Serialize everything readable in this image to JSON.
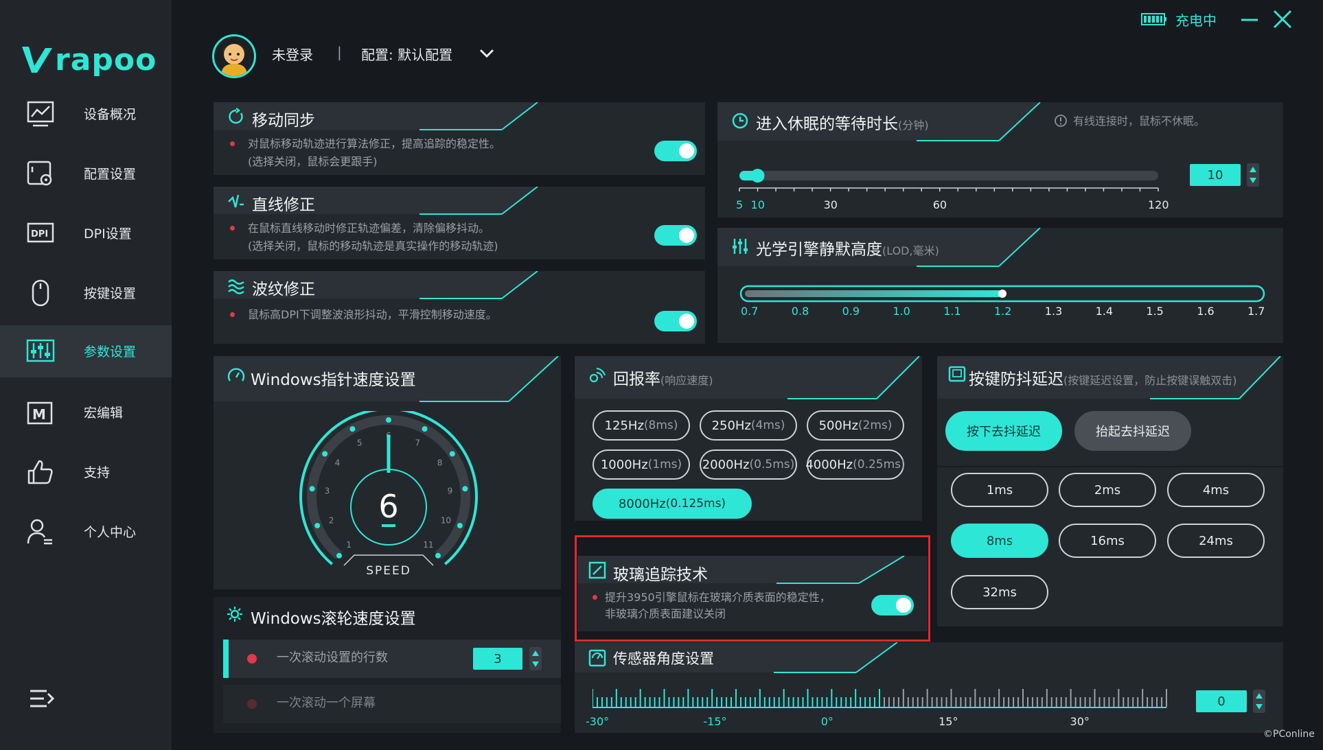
{
  "app": {
    "brand": "rapoo"
  },
  "window": {
    "charging_label": "充电中"
  },
  "user": {
    "status": "未登录",
    "separator": "|",
    "profile_label": "配置: 默认配置"
  },
  "sidebar": {
    "items": [
      {
        "label": "设备概况",
        "icon": "chart-monitor-icon"
      },
      {
        "label": "配置设置",
        "icon": "config-gear-icon"
      },
      {
        "label": "DPI设置",
        "icon": "dpi-icon"
      },
      {
        "label": "按键设置",
        "icon": "mouse-icon"
      },
      {
        "label": "参数设置",
        "icon": "sliders-icon",
        "active": true
      },
      {
        "label": "宏编辑",
        "icon": "macro-icon"
      },
      {
        "label": "支持",
        "icon": "thumbs-up-icon"
      },
      {
        "label": "个人中心",
        "icon": "user-icon"
      }
    ]
  },
  "motion_sync": {
    "title": "移动同步",
    "desc1": "对鼠标移动轨迹进行算法修正，提高追踪的稳定性。",
    "desc2": "(选择关闭，鼠标会更跟手)",
    "enabled": true
  },
  "angle_snap": {
    "title": "直线修正",
    "desc1": "在鼠标直线移动时修正轨迹偏差，清除偏移抖动。",
    "desc2": "(选择关闭，鼠标的移动轨迹是真实操作的移动轨迹)",
    "enabled": true
  },
  "ripple": {
    "title": "波纹修正",
    "desc1": "鼠标高DPI下调整波浪形抖动，平滑控制移动速度。",
    "enabled": true
  },
  "sleep": {
    "title": "进入休眠的等待时长",
    "unit": "(分钟)",
    "note": "有线连接时，鼠标不休眠。",
    "value": "10",
    "ticks": [
      "5",
      "10",
      "30",
      "60",
      "120"
    ],
    "range": [
      5,
      120
    ]
  },
  "lod": {
    "title": "光学引擎静默高度",
    "unit": "(LOD,毫米)",
    "ticks": [
      "0.7",
      "0.8",
      "0.9",
      "1.0",
      "1.1",
      "1.2",
      "1.3",
      "1.4",
      "1.5",
      "1.6",
      "1.7"
    ],
    "value": 1.2
  },
  "pointer_speed": {
    "title": "Windows指针速度设置",
    "value": "6",
    "caption": "SPEED",
    "dial_labels": [
      "1",
      "2",
      "3",
      "4",
      "5",
      "6",
      "7",
      "8",
      "9",
      "10",
      "11"
    ]
  },
  "polling": {
    "title": "回报率",
    "sub": "(响应速度)",
    "options": [
      {
        "hz": "125Hz",
        "ms": "(8ms)"
      },
      {
        "hz": "250Hz",
        "ms": "(4ms)"
      },
      {
        "hz": "500Hz",
        "ms": "(2ms)"
      },
      {
        "hz": "1000Hz",
        "ms": "(1ms)"
      },
      {
        "hz": "2000Hz",
        "ms": "(0.5ms)"
      },
      {
        "hz": "4000Hz",
        "ms": "(0.25ms)"
      },
      {
        "hz": "8000Hz",
        "ms": "(0.125ms)",
        "selected": true
      }
    ]
  },
  "debounce": {
    "title": "按键防抖延迟",
    "sub": "(按键延迟设置，防止按键误触双击)",
    "mode_press": "按下去抖延迟",
    "mode_release": "抬起去抖延迟",
    "options": [
      "1ms",
      "2ms",
      "4ms",
      "8ms",
      "16ms",
      "24ms",
      "32ms"
    ],
    "selected": "8ms"
  },
  "glass": {
    "title": "玻璃追踪技术",
    "desc1": "提升3950引擎鼠标在玻璃介质表面的稳定性，",
    "desc2": "非玻璃介质表面建议关闭",
    "enabled": true
  },
  "scroll": {
    "title": "Windows滚轮速度设置",
    "lines_label": "一次滚动设置的行数",
    "lines_value": "3",
    "screen_label": "一次滚动一个屏幕"
  },
  "sensor_angle": {
    "title": "传感器角度设置",
    "value": "0",
    "ticks": [
      "-30°",
      "-15°",
      "0°",
      "15°",
      "30°"
    ]
  },
  "watermark": "©PConline"
}
